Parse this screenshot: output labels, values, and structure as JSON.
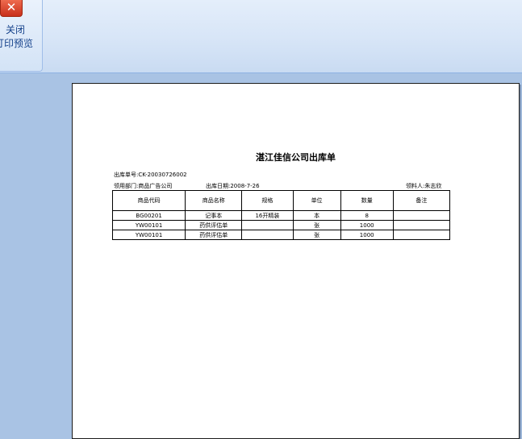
{
  "toolbar": {
    "close_icon_glyph": "✕",
    "close_label_line1": "关闭",
    "close_label_line2": "打印预览"
  },
  "document": {
    "title": "湛江佳信公司出库单",
    "order_no": "出库单号:CK-20030726002",
    "department": "领用部门:商品广告公司",
    "date": "出库日期:2008-7-26",
    "receiver": "领料人:朱志欣",
    "table": {
      "headers": [
        "商品代码",
        "商品名称",
        "规格",
        "单位",
        "数量",
        "备注"
      ],
      "rows": [
        [
          "BG00201",
          "记事本",
          "16开精装",
          "本",
          "8",
          ""
        ],
        [
          "YW00101",
          "药供评估单",
          "",
          "张",
          "1000",
          ""
        ],
        [
          "YW00101",
          "药供评估单",
          "",
          "张",
          "1000",
          ""
        ]
      ]
    }
  }
}
